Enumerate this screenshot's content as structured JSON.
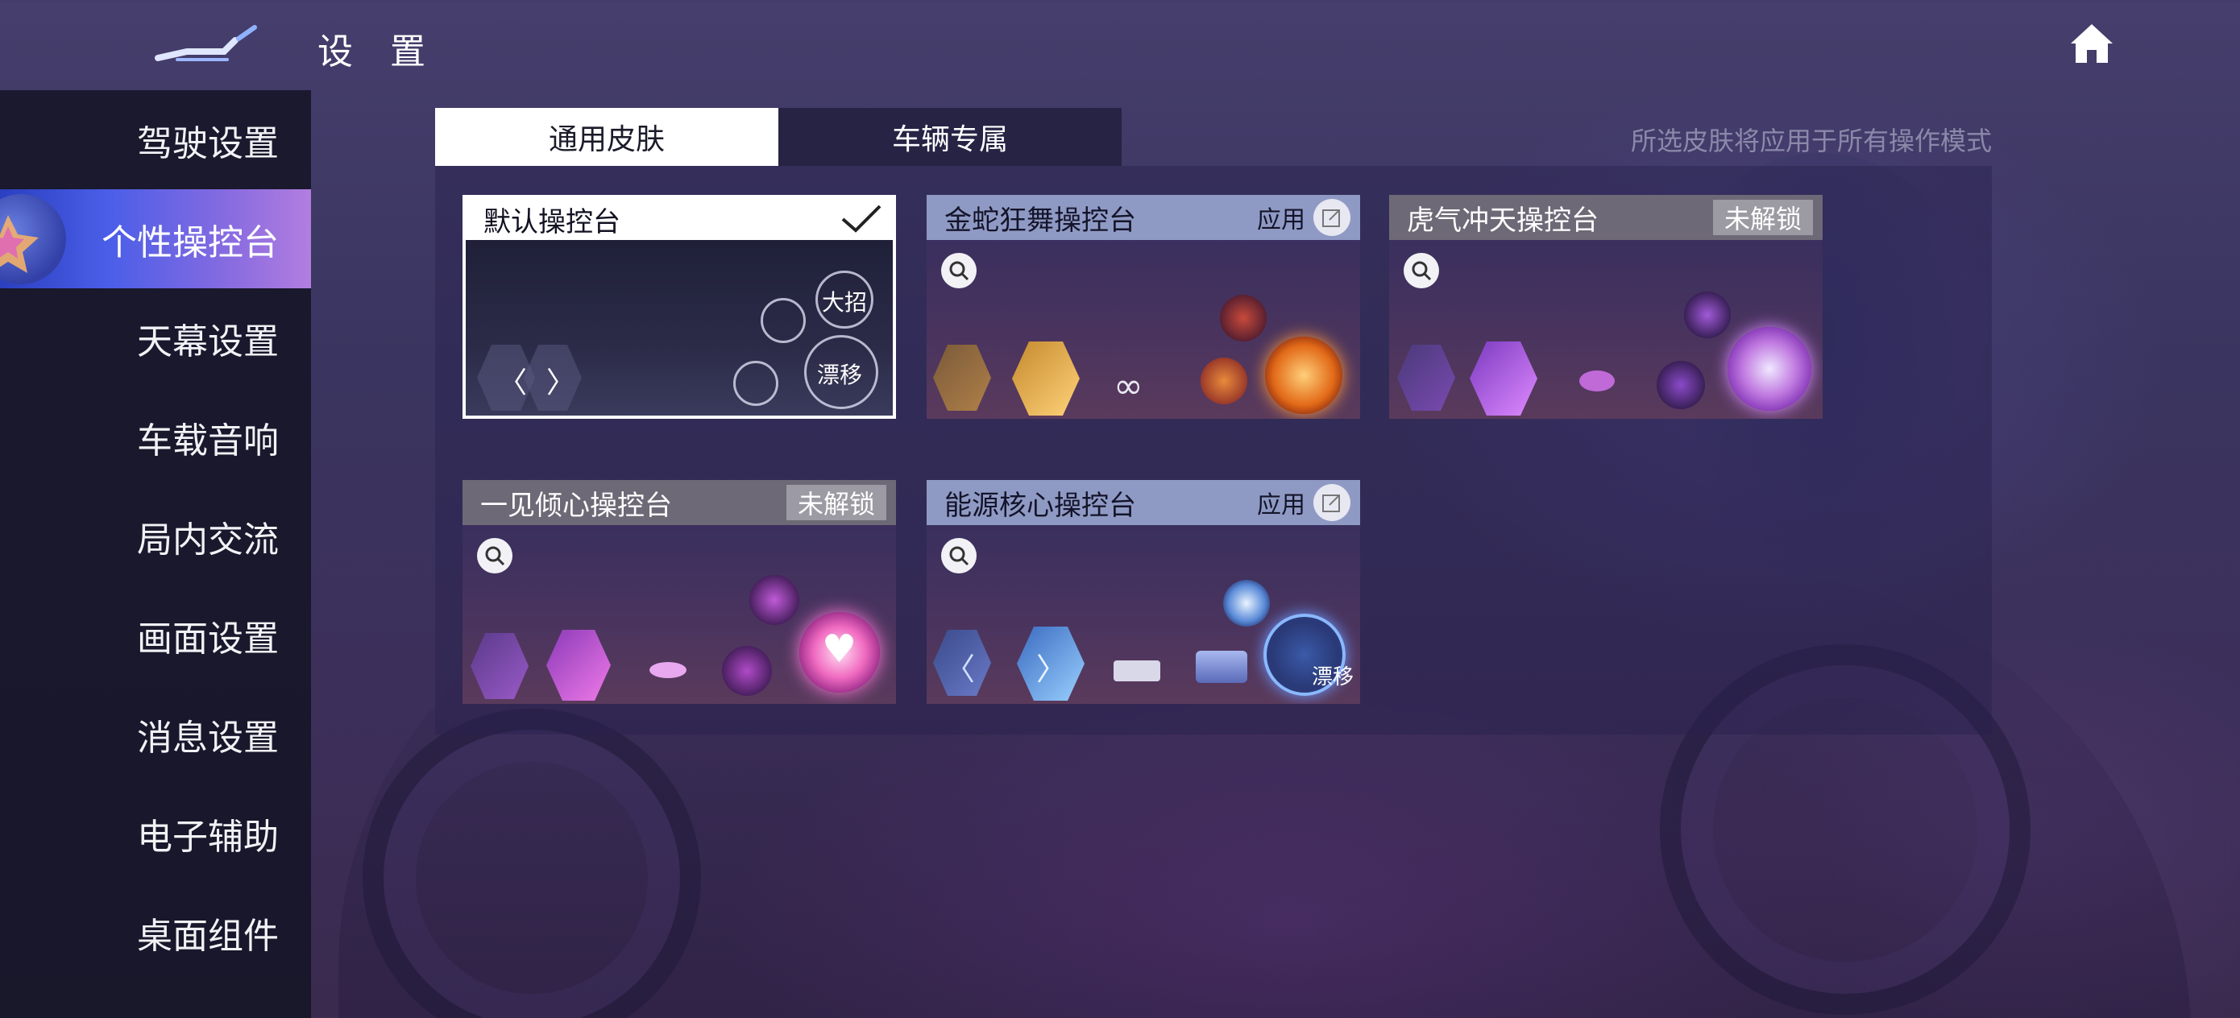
{
  "header": {
    "title": "设 置"
  },
  "sidebar": {
    "items": [
      {
        "label": "驾驶设置"
      },
      {
        "label": "个性操控台"
      },
      {
        "label": "天幕设置"
      },
      {
        "label": "车载音响"
      },
      {
        "label": "局内交流"
      },
      {
        "label": "画面设置"
      },
      {
        "label": "消息设置"
      },
      {
        "label": "电子辅助"
      },
      {
        "label": "桌面组件"
      }
    ],
    "active_index": 1
  },
  "tabs": [
    {
      "label": "通用皮肤"
    },
    {
      "label": "车辆专属"
    }
  ],
  "hint": "所选皮肤将应用于所有操作模式",
  "cards": [
    {
      "name": "默认操控台",
      "status": "selected",
      "controls": {
        "ult": "大招",
        "drift": "漂移"
      }
    },
    {
      "name": "金蛇狂舞操控台",
      "status": "apply",
      "action_label": "应用"
    },
    {
      "name": "虎气冲天操控台",
      "status": "locked",
      "lock_label": "未解锁"
    },
    {
      "name": "一见倾心操控台",
      "status": "locked",
      "lock_label": "未解锁"
    },
    {
      "name": "能源核心操控台",
      "status": "apply",
      "action_label": "应用",
      "controls": {
        "drift": "漂移"
      }
    }
  ],
  "colors": {
    "active_tab_bg": "#ffffff",
    "sidebar_active_start": "#2b3fc0",
    "sidebar_active_end": "#b27ee0",
    "card_head_blue": "#8f9ac4",
    "card_head_gray": "#6e6976",
    "lock_badge": "#9c9aa2"
  }
}
